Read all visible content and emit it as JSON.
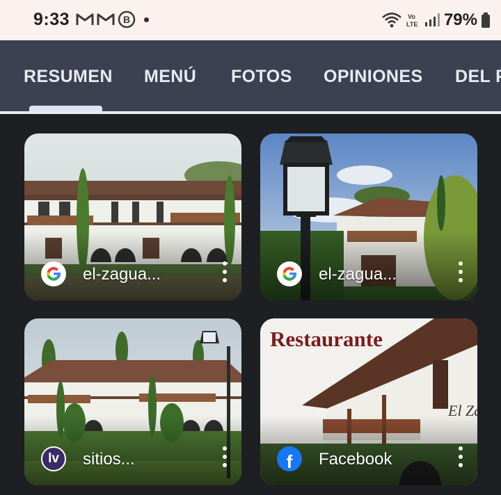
{
  "status_bar": {
    "time": "9:33",
    "battery_percent": "79%",
    "left_icons": [
      "gmail-icon",
      "gmail-icon",
      "bixby-icon",
      "dot-icon"
    ],
    "right_icons": [
      "wifi-icon",
      "volte-icon",
      "signal-icon",
      "battery-icon"
    ],
    "volte_text": "Vo\nLTE"
  },
  "tabs": [
    {
      "label": "RESUMEN",
      "active": true
    },
    {
      "label": "MENÚ",
      "active": false
    },
    {
      "label": "FOTOS",
      "active": false
    },
    {
      "label": "OPINIONES",
      "active": false
    },
    {
      "label": "DEL P",
      "active": false
    }
  ],
  "cards": [
    {
      "source_icon": "google-logo-icon",
      "label": "el-zagua..."
    },
    {
      "source_icon": "google-logo-icon",
      "label": "el-zagua..."
    },
    {
      "source_icon": "sitios-logo-icon",
      "source_icon_text": "lv",
      "label": "sitios..."
    },
    {
      "source_icon": "facebook-logo-icon",
      "source_icon_text": "f",
      "label": "Facebook",
      "photo_text": "Restaurante"
    }
  ],
  "photo_sign_text": "El Zaguan",
  "colors": {
    "status_bar_bg": "#fbf1ee",
    "tab_bar_bg": "#3b4150",
    "page_bg": "#1e1f22",
    "facebook_blue": "#1877f2",
    "sitios_purple": "#3a2a66",
    "restaurante_red": "#7a1c1c"
  }
}
